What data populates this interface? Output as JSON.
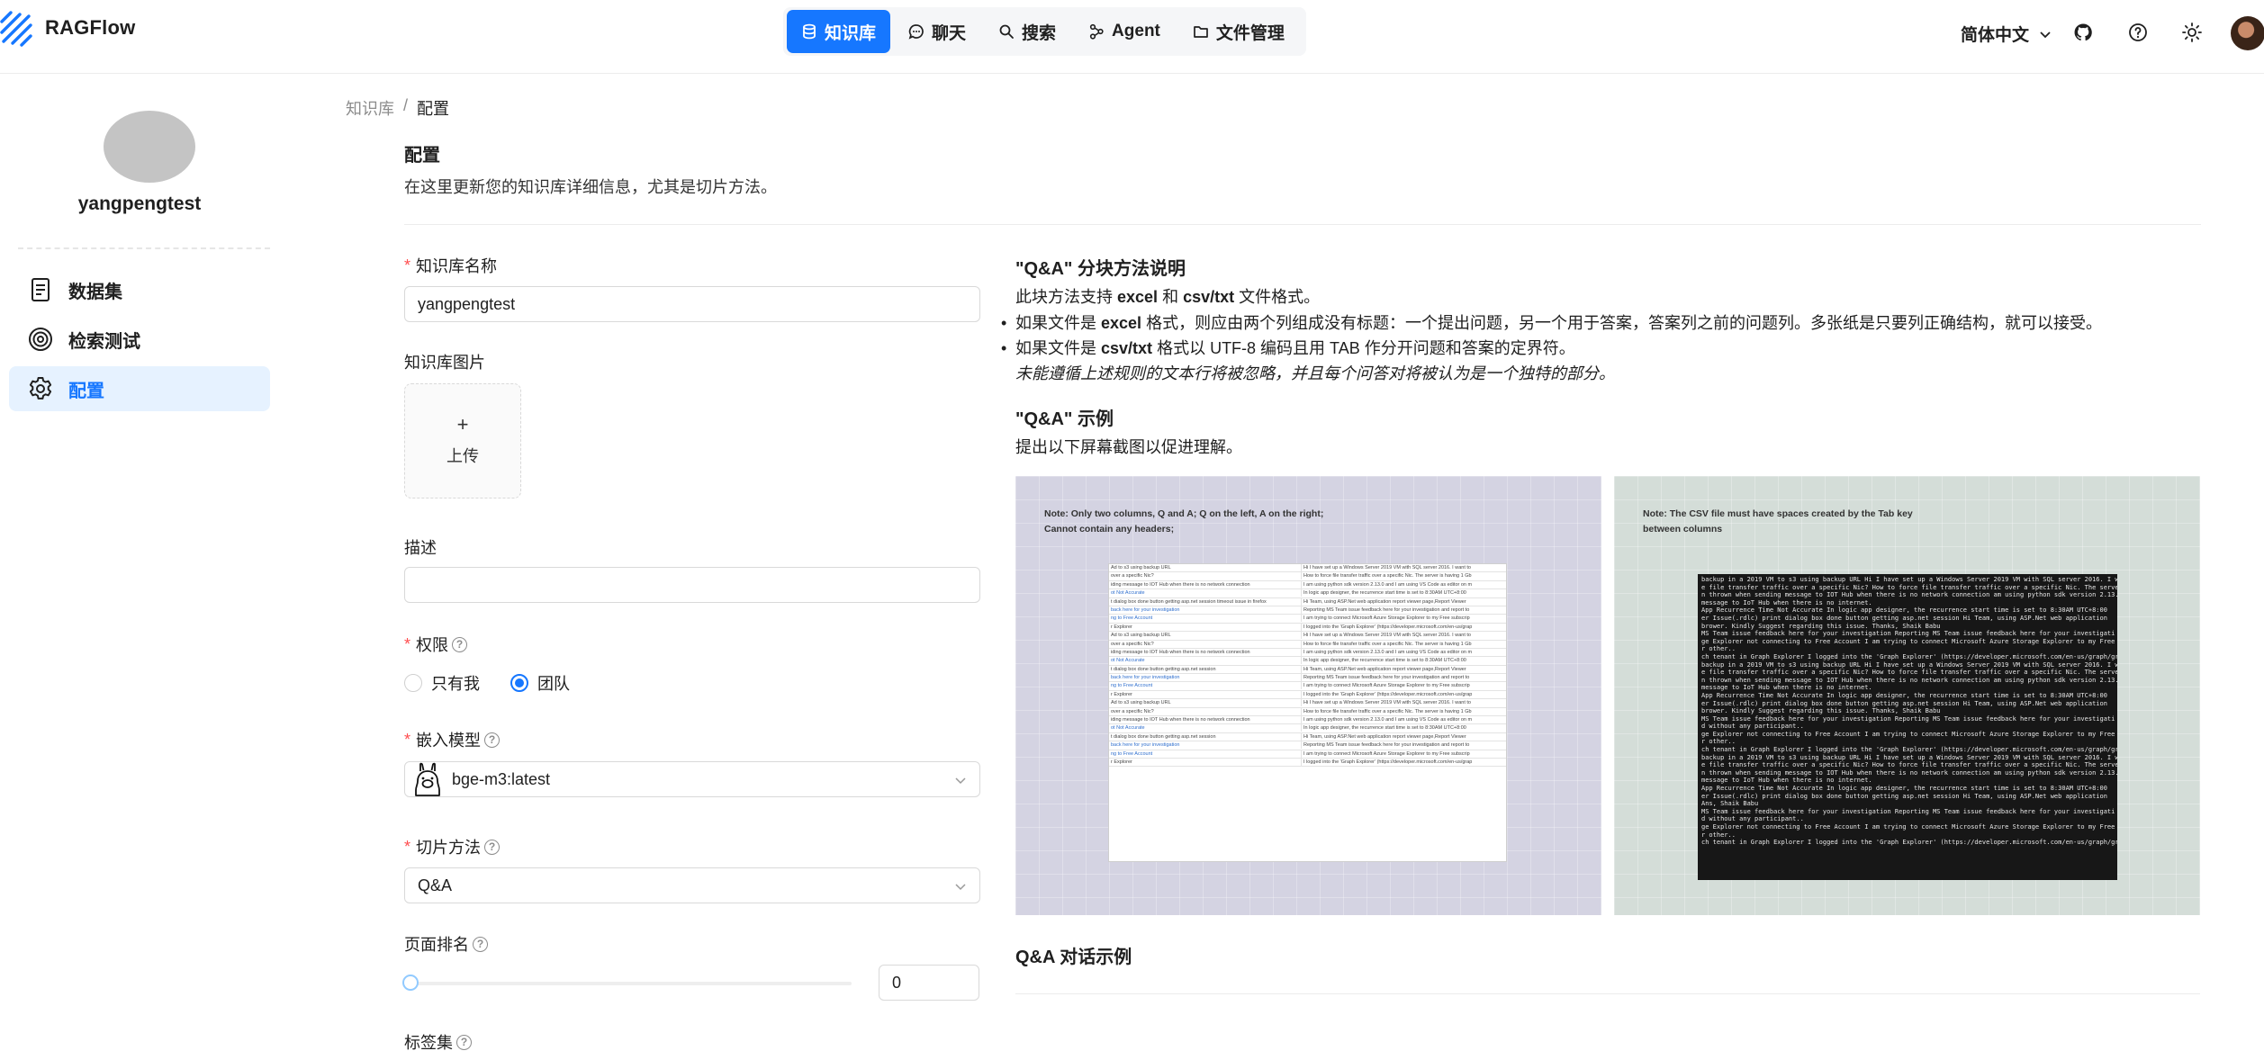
{
  "app": {
    "name": "RAGFlow"
  },
  "nav": [
    {
      "label": "知识库",
      "icon": "database-icon",
      "active": true
    },
    {
      "label": "聊天",
      "icon": "chat-icon",
      "active": false
    },
    {
      "label": "搜索",
      "icon": "search-icon",
      "active": false
    },
    {
      "label": "Agent",
      "icon": "agent-icon",
      "active": false
    },
    {
      "label": "文件管理",
      "icon": "folder-icon",
      "active": false
    }
  ],
  "header": {
    "language": "简体中文",
    "accent": "#1677ff"
  },
  "sidebar": {
    "username": "yangpengtest",
    "items": [
      {
        "label": "数据集",
        "icon": "dataset-icon",
        "active": false
      },
      {
        "label": "检索测试",
        "icon": "retrieval-icon",
        "active": false
      },
      {
        "label": "配置",
        "icon": "settings-icon",
        "active": true
      }
    ]
  },
  "breadcrumb": {
    "root": "知识库",
    "separator": "/",
    "current": "配置"
  },
  "page": {
    "title": "配置",
    "description": "在这里更新您的知识库详细信息，尤其是切片方法。"
  },
  "form": {
    "name_label": "知识库名称",
    "name_value": "yangpengtest",
    "image_label": "知识库图片",
    "upload_plus": "+",
    "upload_label": "上传",
    "description_label": "描述",
    "description_value": "",
    "permission_label": "权限",
    "permission_options": [
      {
        "label": "只有我",
        "selected": false
      },
      {
        "label": "团队",
        "selected": true
      }
    ],
    "embedding_label": "嵌入模型",
    "embedding_value": "bge-m3:latest",
    "chunk_label": "切片方法",
    "chunk_value": "Q&A",
    "pagerank_label": "页面排名",
    "pagerank_value": "0",
    "tagset_label": "标签集"
  },
  "guide": {
    "method_title": "\"Q&A\" 分块方法说明",
    "support_pre": "此块方法支持 ",
    "support_fmt1": "excel",
    "support_mid": " 和 ",
    "support_fmt2": "csv/txt",
    "support_post": " 文件格式。",
    "bullet1_pre": "如果文件是 ",
    "bullet1_fmt": "excel",
    "bullet1_post": " 格式，则应由两个列组成没有标题：一个提出问题，另一个用于答案，答案列之前的问题列。多张纸是只要列正确结构，就可以接受。",
    "bullet2_pre": "如果文件是 ",
    "bullet2_fmt": "csv/txt",
    "bullet2_post": " 格式以 UTF-8 编码且用 TAB 作分开问题和答案的定界符。",
    "note": "未能遵循上述规则的文本行将被忽略，并且每个问答对将被认为是一个独特的部分。",
    "example_title": "\"Q&A\" 示例",
    "example_desc": "提出以下屏幕截图以促进理解。",
    "shot1_note_line1": "Note: Only two columns, Q and A; Q on the left, A on the right;",
    "shot1_note_line2": "Cannot contain any headers;",
    "shot2_note_line1": "Note: The CSV file must have spaces created by the Tab key",
    "shot2_note_line2": "between columns",
    "dialog_title": "Q&A 对话示例"
  }
}
